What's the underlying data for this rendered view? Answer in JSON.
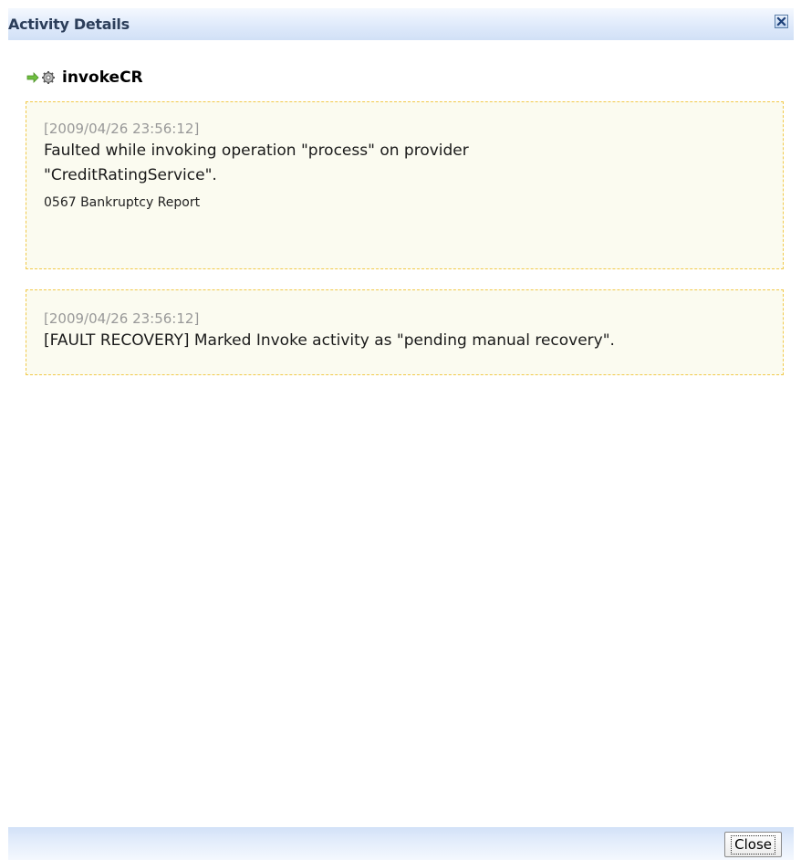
{
  "dialog": {
    "title": "Activity Details"
  },
  "activity": {
    "name": "invokeCR",
    "icon": "invoke-gear-icon"
  },
  "messages": [
    {
      "timestamp": "[2009/04/26 23:56:12]",
      "text": "Faulted while invoking operation \"process\" on provider \"CreditRatingService\".",
      "detail": "0567 Bankruptcy Report"
    },
    {
      "timestamp": "[2009/04/26 23:56:12]",
      "text": "[FAULT RECOVERY] Marked Invoke activity as \"pending manual recovery\"."
    }
  ],
  "footer": {
    "close_label": "Close"
  },
  "colors": {
    "title_bar": "#dfeafb",
    "message_background": "#fbfbf0",
    "message_border": "#f1c94a",
    "timestamp_text": "#999999"
  }
}
